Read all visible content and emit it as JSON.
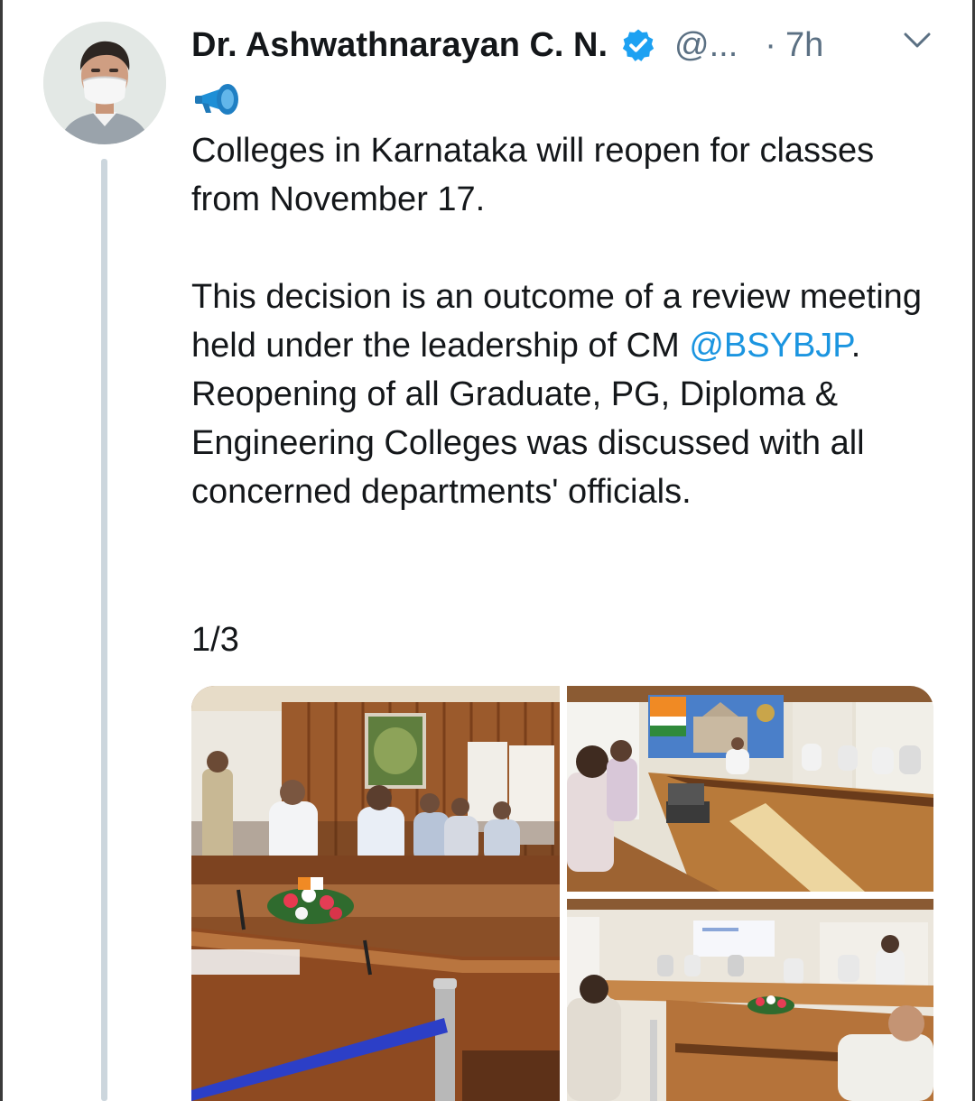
{
  "tweet": {
    "author_name": "Dr. Ashwathnarayan C. N.",
    "handle": "@...",
    "separator": "·",
    "time": "7h",
    "verified": true,
    "paragraph1": "Colleges in Karnataka will reopen for classes from November 17.",
    "paragraph2_before": "This decision is an outcome of a review meeting held under the leadership of CM ",
    "mention": "@BSYBJP",
    "paragraph2_after": ". Reopening of all Graduate, PG, Diploma & Engineering Colleges was discussed with all concerned departments' officials.",
    "thread_counter": "1/3",
    "media_count": 3
  },
  "icons": {
    "verified": "verified-badge-icon",
    "more": "chevron-down-icon",
    "emoji": "megaphone-emoji"
  },
  "colors": {
    "link": "#1b95e0",
    "verified": "#1da1f2",
    "muted": "#5b7083",
    "thread_line": "#ccd6dd"
  }
}
